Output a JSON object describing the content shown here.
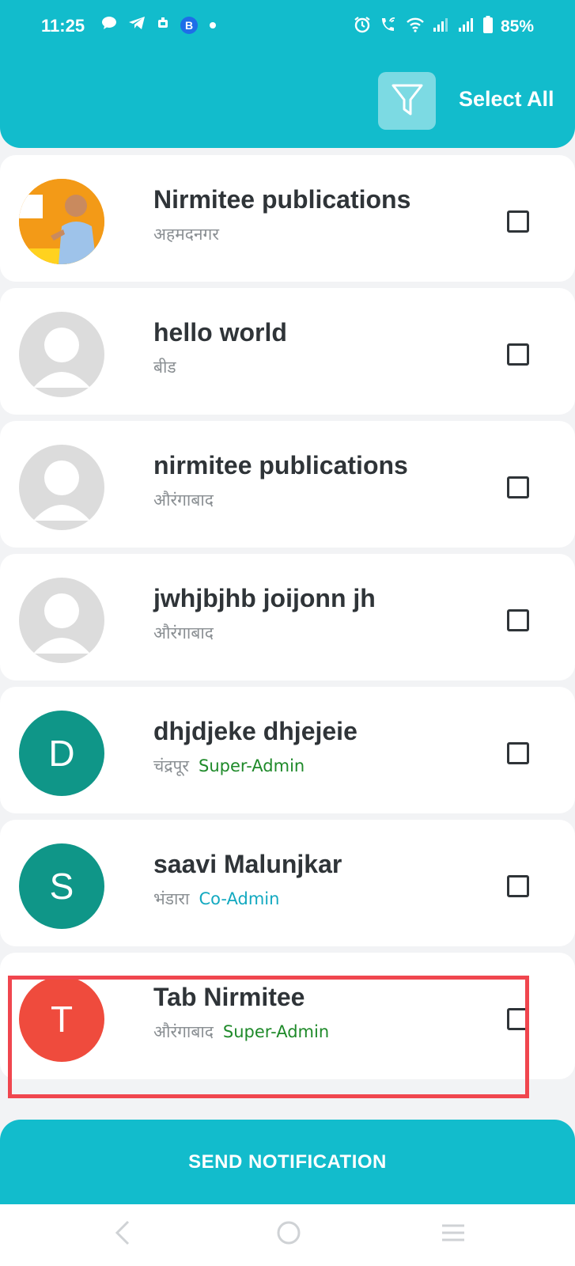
{
  "status_bar": {
    "time": "11:25",
    "app_icons": [
      "chat-bubble-icon",
      "telegram-icon",
      "media-icon",
      "b-app-icon",
      "dot-icon"
    ],
    "b_icon_letter": "B",
    "right_icons": [
      "alarm-icon",
      "wifi-call-icon",
      "wifi-icon",
      "signal-icon",
      "signal-icon",
      "battery-icon"
    ],
    "battery": "85%"
  },
  "header": {
    "filter_icon": "filter-funnel-icon",
    "select_all_label": "Select All",
    "accent_color": "#12bccc"
  },
  "contacts": [
    {
      "name": "Nirmitee publications",
      "district": "अहमदनगर",
      "role": "",
      "avatar": "photo",
      "initial": ""
    },
    {
      "name": "hello world",
      "district": "बीड",
      "role": "",
      "avatar": "placeholder",
      "initial": ""
    },
    {
      "name": "nirmitee publications",
      "district": "औरंगाबाद",
      "role": "",
      "avatar": "placeholder",
      "initial": ""
    },
    {
      "name": "jwhjbjhb joijonn jh",
      "district": "औरंगाबाद",
      "role": "",
      "avatar": "placeholder",
      "initial": ""
    },
    {
      "name": "dhjdjeke dhjejeie",
      "district": "चंद्रपूर",
      "role": "Super-Admin",
      "avatar": "letter",
      "initial": "D"
    },
    {
      "name": "saavi Malunjkar",
      "district": "भंडारा",
      "role": "Co-Admin",
      "avatar": "letter",
      "initial": "S"
    },
    {
      "name": "Tab Nirmitee",
      "district": "औरंगाबाद",
      "role": "Super-Admin",
      "avatar": "letter",
      "initial": "T"
    }
  ],
  "send_button_label": "SEND NOTIFICATION",
  "nav_bar": {
    "items": [
      "back-icon",
      "home-icon",
      "recents-icon"
    ]
  },
  "colors": {
    "super_admin": "#1f8a2a",
    "co_admin": "#13a9c0",
    "highlight": "#f0464e"
  }
}
